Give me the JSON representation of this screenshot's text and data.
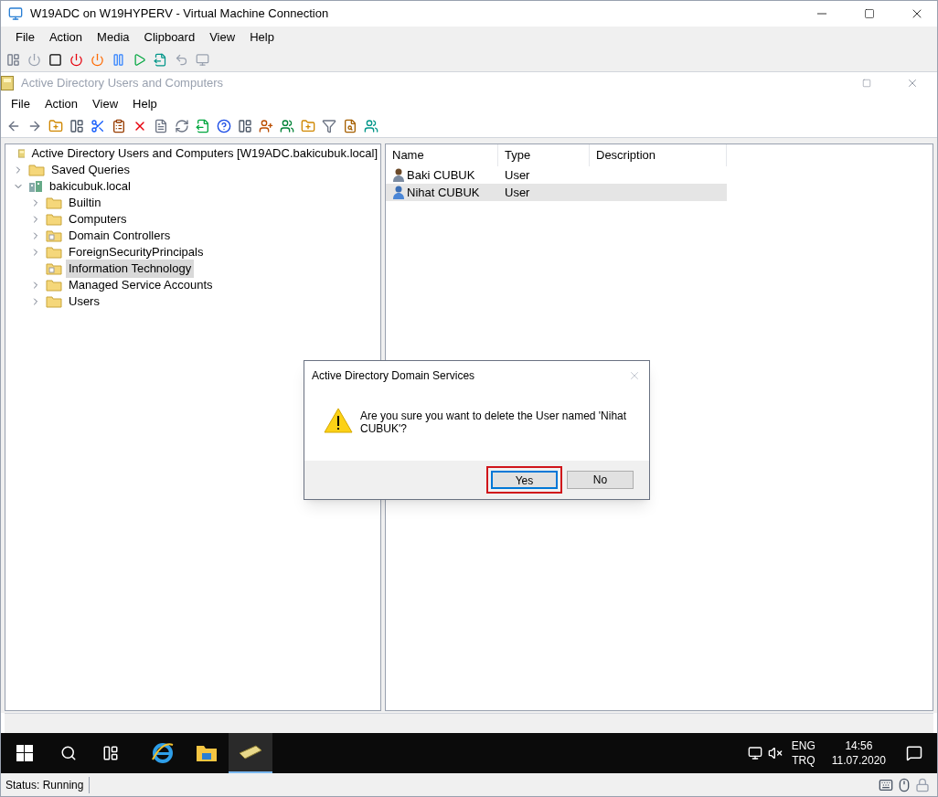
{
  "vm_window": {
    "title": "W19ADC on W19HYPERV - Virtual Machine Connection",
    "menu": [
      "File",
      "Action",
      "Media",
      "Clipboard",
      "View",
      "Help"
    ]
  },
  "app_window": {
    "title": "Active Directory Users and Computers",
    "menu": [
      "File",
      "Action",
      "View",
      "Help"
    ]
  },
  "tree": [
    {
      "label": "Active Directory Users and Computers [W19ADC.bakicubuk.local]",
      "kind": "root",
      "selected": false,
      "children": [
        {
          "label": "Saved Queries",
          "kind": "folder",
          "expanded": false,
          "selected": false
        },
        {
          "label": "bakicubuk.local",
          "kind": "domain",
          "expanded": true,
          "selected": false,
          "children": [
            {
              "label": "Builtin",
              "kind": "folder",
              "expanded": false,
              "selected": false
            },
            {
              "label": "Computers",
              "kind": "folder",
              "expanded": false,
              "selected": false
            },
            {
              "label": "Domain Controllers",
              "kind": "ou",
              "expanded": false,
              "selected": false
            },
            {
              "label": "ForeignSecurityPrincipals",
              "kind": "folder",
              "expanded": false,
              "selected": false
            },
            {
              "label": "Information Technology",
              "kind": "ou",
              "selected": true
            },
            {
              "label": "Managed Service Accounts",
              "kind": "folder",
              "expanded": false,
              "selected": false
            },
            {
              "label": "Users",
              "kind": "folder",
              "expanded": false,
              "selected": false
            }
          ]
        }
      ]
    }
  ],
  "table": {
    "columns": [
      "Name",
      "Type",
      "Description"
    ],
    "rows": [
      {
        "name": "Baki CUBUK",
        "type": "User",
        "selected": false
      },
      {
        "name": "Nihat CUBUK",
        "type": "User",
        "selected": true
      }
    ]
  },
  "dialog": {
    "title": "Active Directory Domain Services",
    "message": "Are you sure you want to delete the User named 'Nihat CUBUK'?",
    "buttons": [
      {
        "label": "Yes",
        "selected": true
      },
      {
        "label": "No",
        "selected": false
      }
    ]
  },
  "taskbar": {
    "apps": [
      {
        "kind": "ie",
        "selected": false
      },
      {
        "kind": "explorer",
        "selected": false
      },
      {
        "kind": "aduc",
        "selected": true
      }
    ],
    "language": [
      "ENG",
      "TRQ"
    ],
    "time": "14:56",
    "date": "11.07.2020"
  },
  "status_bar": {
    "text": "Status: Running"
  }
}
